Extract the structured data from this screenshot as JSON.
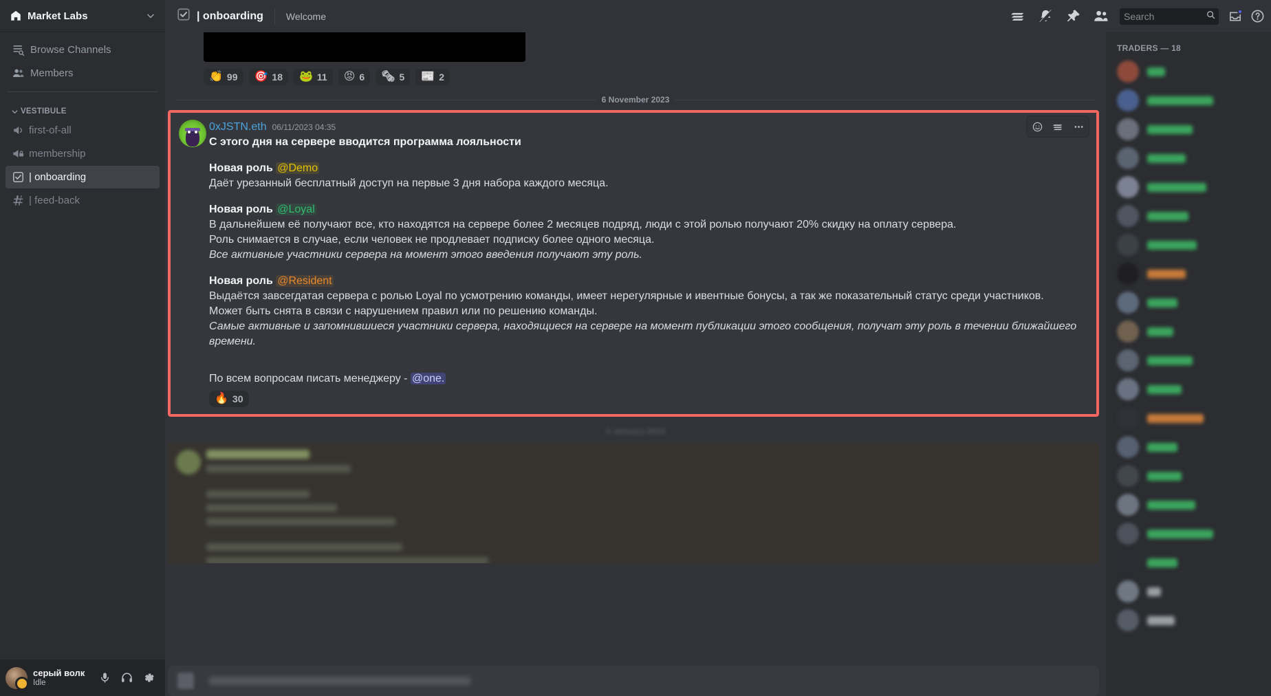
{
  "server": {
    "name": "Market Labs",
    "icon": "home-icon",
    "chevron": "chevron-down-icon"
  },
  "sidebar": {
    "nav": [
      {
        "label": "Browse Channels",
        "icon": "browse-channels-icon"
      },
      {
        "label": "Members",
        "icon": "members-icon"
      }
    ],
    "category": {
      "label": "VESTIBULE",
      "icon": "chevron-down-icon"
    },
    "channels": [
      {
        "label": "first-of-all",
        "icon": "announcement-channel-icon",
        "active": false
      },
      {
        "label": "membership",
        "icon": "announcement-locked-channel-icon",
        "active": false
      },
      {
        "label": "| onboarding",
        "icon": "rules-channel-icon",
        "active": true
      },
      {
        "label": "| feed-back",
        "icon": "hash-channel-icon",
        "active": false
      }
    ]
  },
  "user_panel": {
    "name": "серый волк",
    "status": "Idle",
    "buttons": [
      {
        "name": "mute-button",
        "icon": "microphone-icon"
      },
      {
        "name": "deafen-button",
        "icon": "headphones-icon"
      },
      {
        "name": "user-settings-button",
        "icon": "gear-icon"
      }
    ]
  },
  "topbar": {
    "channel_icon": "rules-channel-icon",
    "channel_name": "| onboarding",
    "topic": "Welcome",
    "icons": [
      {
        "name": "threads-icon",
        "label": "Threads"
      },
      {
        "name": "notification-muted-icon",
        "label": "Notification Settings"
      },
      {
        "name": "pin-icon",
        "label": "Pinned Messages"
      },
      {
        "name": "members-icon",
        "label": "Member List"
      }
    ],
    "search": {
      "placeholder": "Search",
      "value": "",
      "icon": "search-icon"
    },
    "inbox_icon": "inbox-icon",
    "help_icon": "help-icon"
  },
  "chat": {
    "top_attachment_reactions": [
      {
        "emoji": "👏",
        "count": "99"
      },
      {
        "emoji": "🎯",
        "count": "18"
      },
      {
        "emoji": "🐸",
        "count": "11"
      },
      {
        "emoji": "😡",
        "count": "6"
      },
      {
        "emoji": "🗞",
        "count": "5"
      },
      {
        "emoji": "📰",
        "count": "2"
      }
    ],
    "date_divider": "6 November 2023",
    "date_divider_2": "3 January 2024",
    "message": {
      "author": "0xJSTN.eth",
      "timestamp": "06/11/2023 04:35",
      "title": "С этого дня на сервере вводится программа лояльности",
      "sections": [
        {
          "role_prefix": "Новая роль ",
          "role_mention": "@Demo",
          "role_kind": "demo",
          "lines": [
            {
              "text": "Даёт урезанный бесплатный доступ на первые 3 дня набора каждого месяца.",
              "italic": false
            }
          ]
        },
        {
          "role_prefix": "Новая роль ",
          "role_mention": "@Loyal",
          "role_kind": "loyal",
          "lines": [
            {
              "text": "В дальнейшем её получают все, кто находятся на сервере более 2 месяцев подряд, люди с этой ролью получают 20% скидку на оплату сервера.",
              "italic": false
            },
            {
              "text": "Роль снимается в случае, если человек не продлевает подписку более одного месяца.",
              "italic": false
            },
            {
              "text": "Все активные участники сервера на момент этого введения получают эту роль.",
              "italic": true
            }
          ]
        },
        {
          "role_prefix": "Новая роль ",
          "role_mention": "@Resident",
          "role_kind": "resident",
          "lines": [
            {
              "text": "Выдаётся завсегдатая сервера с ролью Loyal по усмотрению команды, имеет нерегулярные и ивентные бонусы, а так же показательный статус среди участников.",
              "italic": false
            },
            {
              "text": "Может быть снята в связи с нарушением правил или по решению команды.",
              "italic": false
            },
            {
              "text": "Самые активные и запомнившиеся участники сервера, находящиеся на сервере на момент публикации этого сообщения, получат эту роль в течении ближайшего времени.",
              "italic": true
            }
          ]
        }
      ],
      "footer_prefix": "По всем вопросам писать менеджеру - ",
      "footer_mention": "@one.",
      "reactions": [
        {
          "emoji": "🔥",
          "count": "30"
        }
      ],
      "actions": [
        {
          "name": "add-reaction-button",
          "icon": "emoji-smile-icon"
        },
        {
          "name": "create-thread-button",
          "icon": "threads-icon"
        },
        {
          "name": "more-options-button",
          "icon": "more-horizontal-icon"
        }
      ]
    }
  },
  "members": {
    "header": "TRADERS — 18",
    "rows": [
      {
        "avatar": "#8d4a3a",
        "name_color": "#3ba55d",
        "name_width": 26
      },
      {
        "avatar": "#4a5f8d",
        "name_color": "#3ba55d",
        "name_width": 96
      },
      {
        "avatar": "#6b6f7a",
        "name_color": "#3ba55d",
        "name_width": 66
      },
      {
        "avatar": "#5a6470",
        "name_color": "#3ba55d",
        "name_width": 56
      },
      {
        "avatar": "#7a8190",
        "name_color": "#3ba55d",
        "name_width": 86
      },
      {
        "avatar": "#4e5560",
        "name_color": "#3ba55d",
        "name_width": 60
      },
      {
        "avatar": "#3c4148",
        "name_color": "#3ba55d",
        "name_width": 72
      },
      {
        "avatar": "#1f1f22",
        "name_color": "#c77b3a",
        "name_width": 56
      },
      {
        "avatar": "#5d6a7b",
        "name_color": "#3ba55d",
        "name_width": 44
      },
      {
        "avatar": "#70614f",
        "name_color": "#3ba55d",
        "name_width": 38
      },
      {
        "avatar": "#5b6470",
        "name_color": "#3ba55d",
        "name_width": 66
      },
      {
        "avatar": "#6a7282",
        "name_color": "#3ba55d",
        "name_width": 50
      },
      {
        "avatar": "#2f3338",
        "name_color": "#c77b3a",
        "name_width": 82
      },
      {
        "avatar": "#566070",
        "name_color": "#3ba55d",
        "name_width": 44
      },
      {
        "avatar": "#42474e",
        "name_color": "#3ba55d",
        "name_width": 50
      },
      {
        "avatar": "#6d7581",
        "name_color": "#3ba55d",
        "name_width": 70
      },
      {
        "avatar": "#4b525b",
        "name_color": "#3ba55d",
        "name_width": 96
      },
      {
        "avatar": "#2b2f34",
        "name_color": "#3ba55d",
        "name_width": 44
      },
      {
        "avatar": "#6f7783",
        "name_color": "#9aa0a6",
        "name_width": 20
      },
      {
        "avatar": "#555c66",
        "name_color": "#9aa0a6",
        "name_width": 40
      }
    ]
  }
}
